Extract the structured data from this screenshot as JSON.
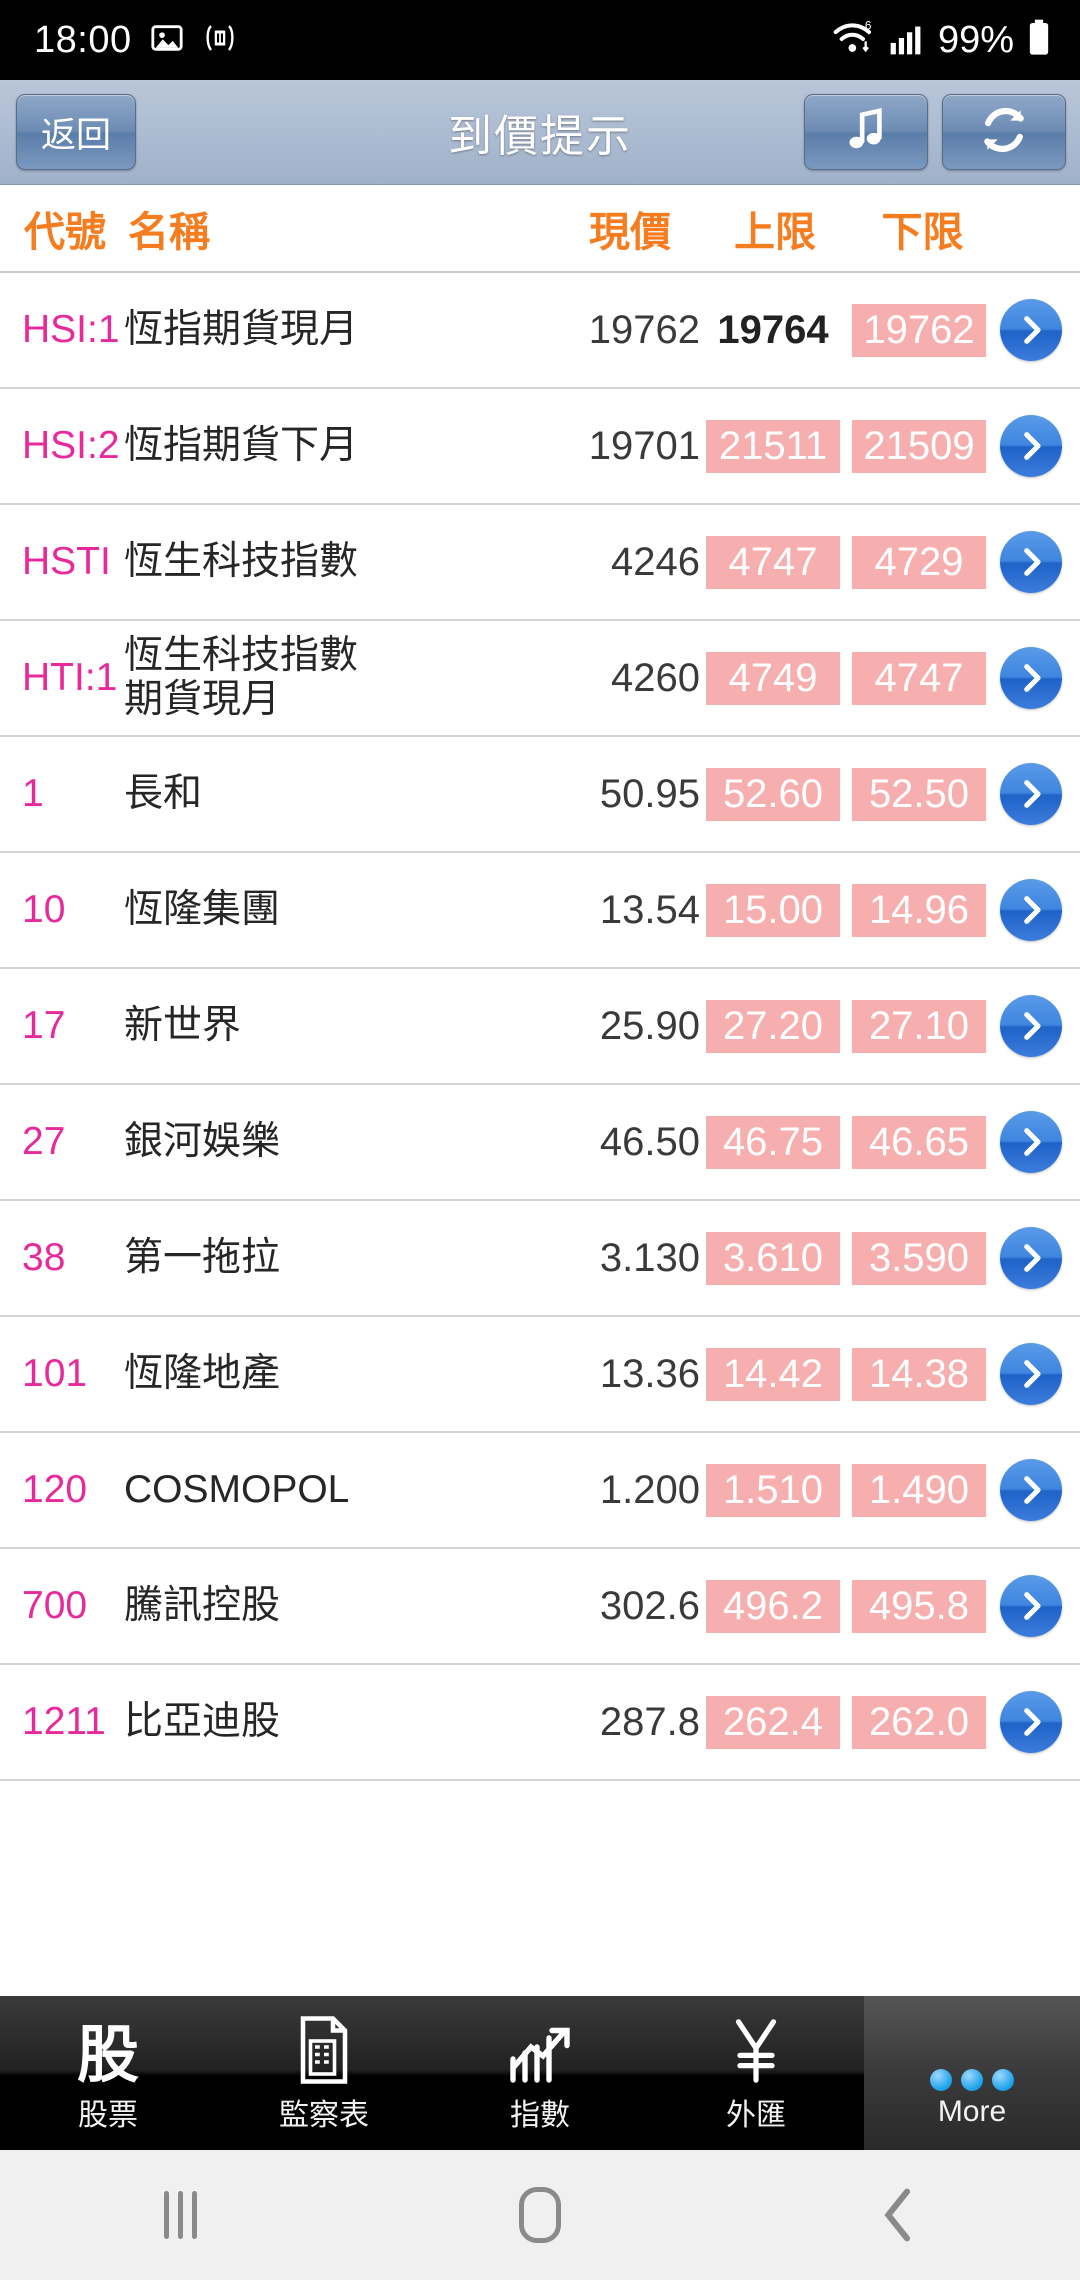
{
  "status_bar": {
    "time": "18:00",
    "battery_percent": "99%",
    "icons": [
      "image-icon",
      "tdstock-pro-notification-icon",
      "wifi-icon",
      "signal-icon",
      "battery-icon"
    ],
    "wifi_badge": "6"
  },
  "header": {
    "back_label": "返回",
    "title": "到價提示",
    "music_button": "♫",
    "refresh_button": "⟳"
  },
  "table": {
    "columns": {
      "code": "代號",
      "name": "名稱",
      "price": "現價",
      "upper": "上限",
      "lower": "下限"
    },
    "rows": [
      {
        "code": "HSI:1",
        "name": "恆指期貨現月",
        "price": "19762",
        "upper": "19764",
        "lower": "19762",
        "upper_style": "bold-plain",
        "lower_style": "pink"
      },
      {
        "code": "HSI:2",
        "name": "恆指期貨下月",
        "price": "19701",
        "upper": "21511",
        "lower": "21509",
        "upper_style": "pink",
        "lower_style": "pink"
      },
      {
        "code": "HSTI",
        "name": "恆生科技指數",
        "price": "4246",
        "upper": "4747",
        "lower": "4729",
        "upper_style": "pink",
        "lower_style": "pink"
      },
      {
        "code": "HTI:1",
        "name": "恆生科技指數\n期貨現月",
        "price": "4260",
        "upper": "4749",
        "lower": "4747",
        "upper_style": "pink",
        "lower_style": "pink"
      },
      {
        "code": "1",
        "name": "長和",
        "price": "50.95",
        "upper": "52.60",
        "lower": "52.50",
        "upper_style": "pink",
        "lower_style": "pink"
      },
      {
        "code": "10",
        "name": "恆隆集團",
        "price": "13.54",
        "upper": "15.00",
        "lower": "14.96",
        "upper_style": "pink",
        "lower_style": "pink"
      },
      {
        "code": "17",
        "name": "新世界",
        "price": "25.90",
        "upper": "27.20",
        "lower": "27.10",
        "upper_style": "pink",
        "lower_style": "pink"
      },
      {
        "code": "27",
        "name": "銀河娛樂",
        "price": "46.50",
        "upper": "46.75",
        "lower": "46.65",
        "upper_style": "pink",
        "lower_style": "pink"
      },
      {
        "code": "38",
        "name": "第一拖拉",
        "price": "3.130",
        "upper": "3.610",
        "lower": "3.590",
        "upper_style": "pink",
        "lower_style": "pink"
      },
      {
        "code": "101",
        "name": "恆隆地產",
        "price": "13.36",
        "upper": "14.42",
        "lower": "14.38",
        "upper_style": "pink",
        "lower_style": "pink"
      },
      {
        "code": "120",
        "name": "COSMOPOL",
        "price": "1.200",
        "upper": "1.510",
        "lower": "1.490",
        "upper_style": "pink",
        "lower_style": "pink"
      },
      {
        "code": "700",
        "name": "騰訊控股",
        "price": "302.6",
        "upper": "496.2",
        "lower": "495.8",
        "upper_style": "pink",
        "lower_style": "pink"
      },
      {
        "code": "1211",
        "name": "比亞迪股",
        "price": "287.8",
        "upper": "262.4",
        "lower": "262.0",
        "upper_style": "pink",
        "lower_style": "pink"
      }
    ]
  },
  "tabbar": {
    "items": [
      {
        "label": "股票",
        "icon": "stock-glyph-icon",
        "selected": false
      },
      {
        "label": "監察表",
        "icon": "watchlist-document-icon",
        "selected": false
      },
      {
        "label": "指數",
        "icon": "index-chart-icon",
        "selected": false
      },
      {
        "label": "外匯",
        "icon": "yen-currency-icon",
        "selected": false
      },
      {
        "label": "More",
        "icon": "more-dots-icon",
        "selected": true
      }
    ]
  },
  "navbar": {
    "recents": "recents-icon",
    "home": "home-icon",
    "back": "back-icon"
  },
  "colors": {
    "accent_orange": "#f57c1f",
    "code_pink": "#e8299b",
    "alert_pink_bg": "#f7aeae",
    "arrow_blue": "#2f7ddd",
    "header_blue": "#aebdd2"
  }
}
